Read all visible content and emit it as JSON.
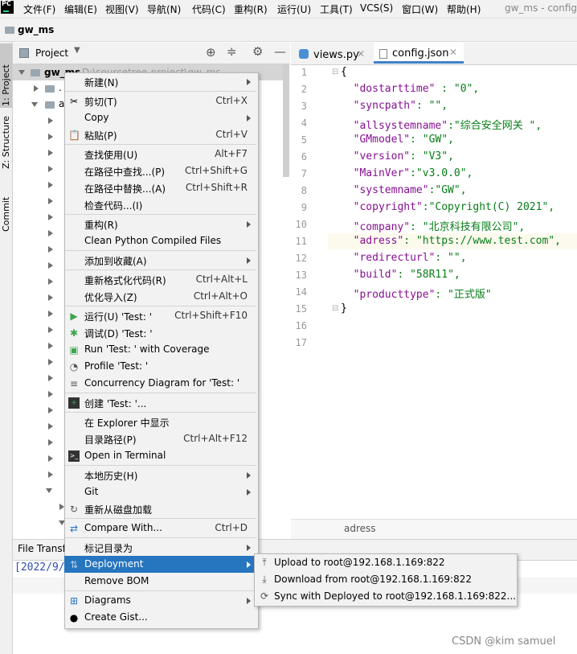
{
  "menubar": {
    "items": [
      "文件(F)",
      "编辑(E)",
      "视图(V)",
      "导航(N)",
      "代码(C)",
      "重构(R)",
      "运行(U)",
      "工具(T)",
      "VCS(S)",
      "窗口(W)",
      "帮助(H)"
    ],
    "window_title": "gw_ms - config."
  },
  "navbar": {
    "project": "gw_ms"
  },
  "left_stripe": {
    "project": "1: Project",
    "structure": "Z: Structure",
    "commit": "Commit"
  },
  "project_panel": {
    "title": "Project",
    "root": "gw_ms",
    "root_path": "D:\\sourcetree-project\\gw_ms",
    "child_1": ".",
    "child_2": "a"
  },
  "editor": {
    "tabs": [
      {
        "label": "views.py",
        "active": false
      },
      {
        "label": "config.json",
        "active": true
      }
    ],
    "lines": [
      {
        "n": "1",
        "key": "",
        "val": "{"
      },
      {
        "n": "2",
        "key": "\"dostarttime\"",
        "val": " : \"0\","
      },
      {
        "n": "3",
        "key": "\"syncpath\"",
        "val": ": \"\","
      },
      {
        "n": "4",
        "key": "\"allsystemname\"",
        "val": ":\"综合安全网关 \","
      },
      {
        "n": "5",
        "key": "\"GMmodel\"",
        "val": ": \"GW\","
      },
      {
        "n": "6",
        "key": "\"version\"",
        "val": ": \"V3\","
      },
      {
        "n": "7",
        "key": "\"MainVer\"",
        "val": ":\"v3.0.0\","
      },
      {
        "n": "8",
        "key": "\"systemname\"",
        "val": ":\"GW\","
      },
      {
        "n": "9",
        "key": "\"copyright\"",
        "val": ":\"Copyright(C) 2021\","
      },
      {
        "n": "10",
        "key": "\"company\"",
        "val": ": \"北京科技有限公司\","
      },
      {
        "n": "11",
        "key": "\"adress\"",
        "val": ": \"https://www.test.com\","
      },
      {
        "n": "12",
        "key": "\"redirecturl\"",
        "val": ": \"\","
      },
      {
        "n": "13",
        "key": "\"build\"",
        "val": ": \"58R11\","
      },
      {
        "n": "14",
        "key": "\"producttype\"",
        "val": ": \"正式版\""
      },
      {
        "n": "15",
        "key": "",
        "val": "}"
      },
      {
        "n": "16",
        "key": "",
        "val": ""
      },
      {
        "n": "17",
        "key": "",
        "val": ""
      }
    ],
    "status_breadcrumb": "adress"
  },
  "bottom_panel": {
    "title": "File Transf",
    "log": "[2022/9/"
  },
  "context_menu": {
    "new": {
      "label": "新建(N)"
    },
    "cut": {
      "label": "剪切(T)",
      "shortcut": "Ctrl+X"
    },
    "copy": {
      "label": "Copy"
    },
    "paste": {
      "label": "粘贴(P)",
      "shortcut": "Ctrl+V"
    },
    "find_usages": {
      "label": "查找使用(U)",
      "shortcut": "Alt+F7"
    },
    "find_in_path": {
      "label": "在路径中查找...(P)",
      "shortcut": "Ctrl+Shift+G"
    },
    "replace_in_path": {
      "label": "在路径中替换...(A)",
      "shortcut": "Ctrl+Shift+R"
    },
    "inspect_code": {
      "label": "检查代码...(I)"
    },
    "refactor": {
      "label": "重构(R)"
    },
    "clean_python": {
      "label": "Clean Python Compiled Files"
    },
    "add_favorites": {
      "label": "添加到收藏(A)"
    },
    "reformat": {
      "label": "重新格式化代码(R)",
      "shortcut": "Ctrl+Alt+L"
    },
    "optimize_imports": {
      "label": "优化导入(Z)",
      "shortcut": "Ctrl+Alt+O"
    },
    "run": {
      "label": "运行(U) 'Test: '",
      "shortcut": "Ctrl+Shift+F10"
    },
    "debug": {
      "label": "调试(D) 'Test: '"
    },
    "coverage": {
      "label": "Run 'Test: ' with Coverage"
    },
    "profile": {
      "label": "Profile 'Test: '"
    },
    "concurrency": {
      "label": "Concurrency Diagram for 'Test: '"
    },
    "create": {
      "label": "创建 'Test: '..."
    },
    "explorer": {
      "label": "在 Explorer 中显示"
    },
    "dir_path": {
      "label": "目录路径(P)",
      "shortcut": "Ctrl+Alt+F12"
    },
    "terminal": {
      "label": "Open in Terminal"
    },
    "local_history": {
      "label": "本地历史(H)"
    },
    "git": {
      "label": "Git"
    },
    "reload": {
      "label": "重新从磁盘加载"
    },
    "compare": {
      "label": "Compare With...",
      "shortcut": "Ctrl+D"
    },
    "mark_dir": {
      "label": "标记目录为"
    },
    "deployment": {
      "label": "Deployment"
    },
    "remove_bom": {
      "label": "Remove BOM"
    },
    "diagrams": {
      "label": "Diagrams"
    },
    "gist": {
      "label": "Create Gist..."
    }
  },
  "submenu": {
    "upload": "Upload to root@192.168.1.169:822",
    "download": "Download from root@192.168.1.169:822",
    "sync": "Sync with Deployed to root@192.168.1.169:822..."
  },
  "watermark": "CSDN @kim samuel",
  "colors": {
    "selection": "#2675bf",
    "json_key": "#871094",
    "json_value": "#067d17",
    "run_green": "#3fa34d"
  }
}
